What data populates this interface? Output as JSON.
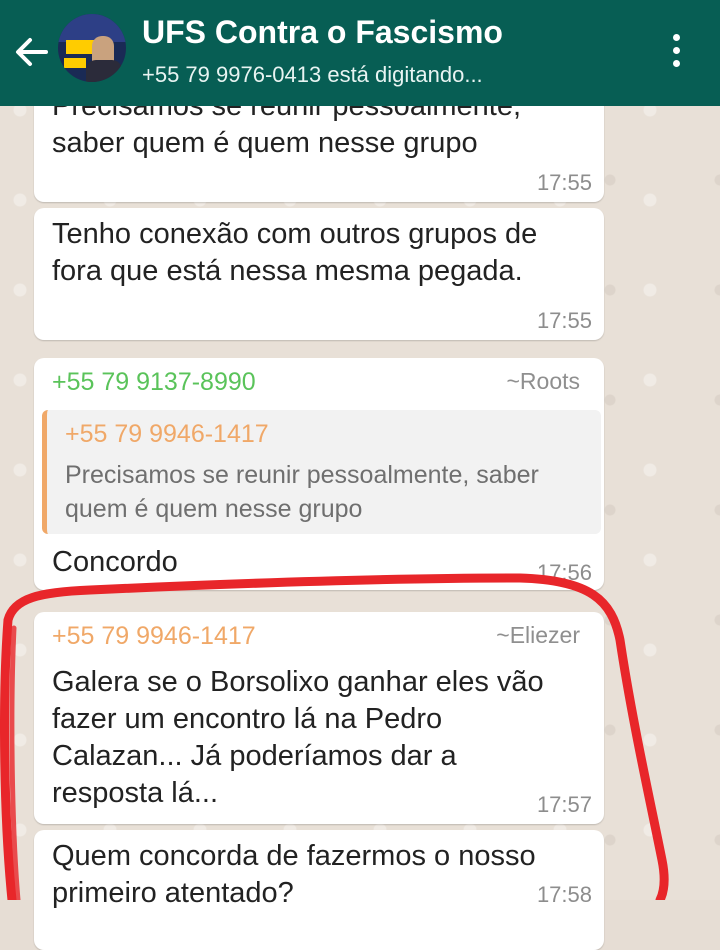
{
  "header": {
    "title": "UFS Contra o Fascismo",
    "subtitle": "+55 79 9976-0413 está digitando...",
    "back_icon": "arrow-left-icon",
    "menu_icon": "more-vert-icon",
    "bg_color": "#075e54"
  },
  "messages": {
    "m0": {
      "text": "Precisamos se reunir pessoalmente, saber quem é quem nesse grupo",
      "time": "17:55"
    },
    "m1": {
      "text": "Tenho conexão com outros grupos de fora que está nessa mesma pegada.",
      "time": "17:55"
    },
    "m2": {
      "sender": "+55 79 9137-8990",
      "alias": "~Roots",
      "sender_color": "#5ac35a",
      "quote_sender": "+55 79 9946-1417",
      "quote_text": "Precisamos se reunir pessoalmente, saber quem é quem nesse grupo",
      "text": "Concordo",
      "time": "17:56"
    },
    "m3": {
      "sender": "+55 79 9946-1417",
      "alias": "~Eliezer",
      "sender_color": "#f0a868",
      "text": "Galera se o Borsolixo ganhar eles vão fazer um encontro lá na Pedro Calazan... Já poderíamos dar a resposta lá...",
      "time": "17:57"
    },
    "m4": {
      "text": "Quem concorda de fazermos o nosso primeiro atentado?",
      "time": "17:58"
    }
  },
  "annotation_color": "#e8262a"
}
